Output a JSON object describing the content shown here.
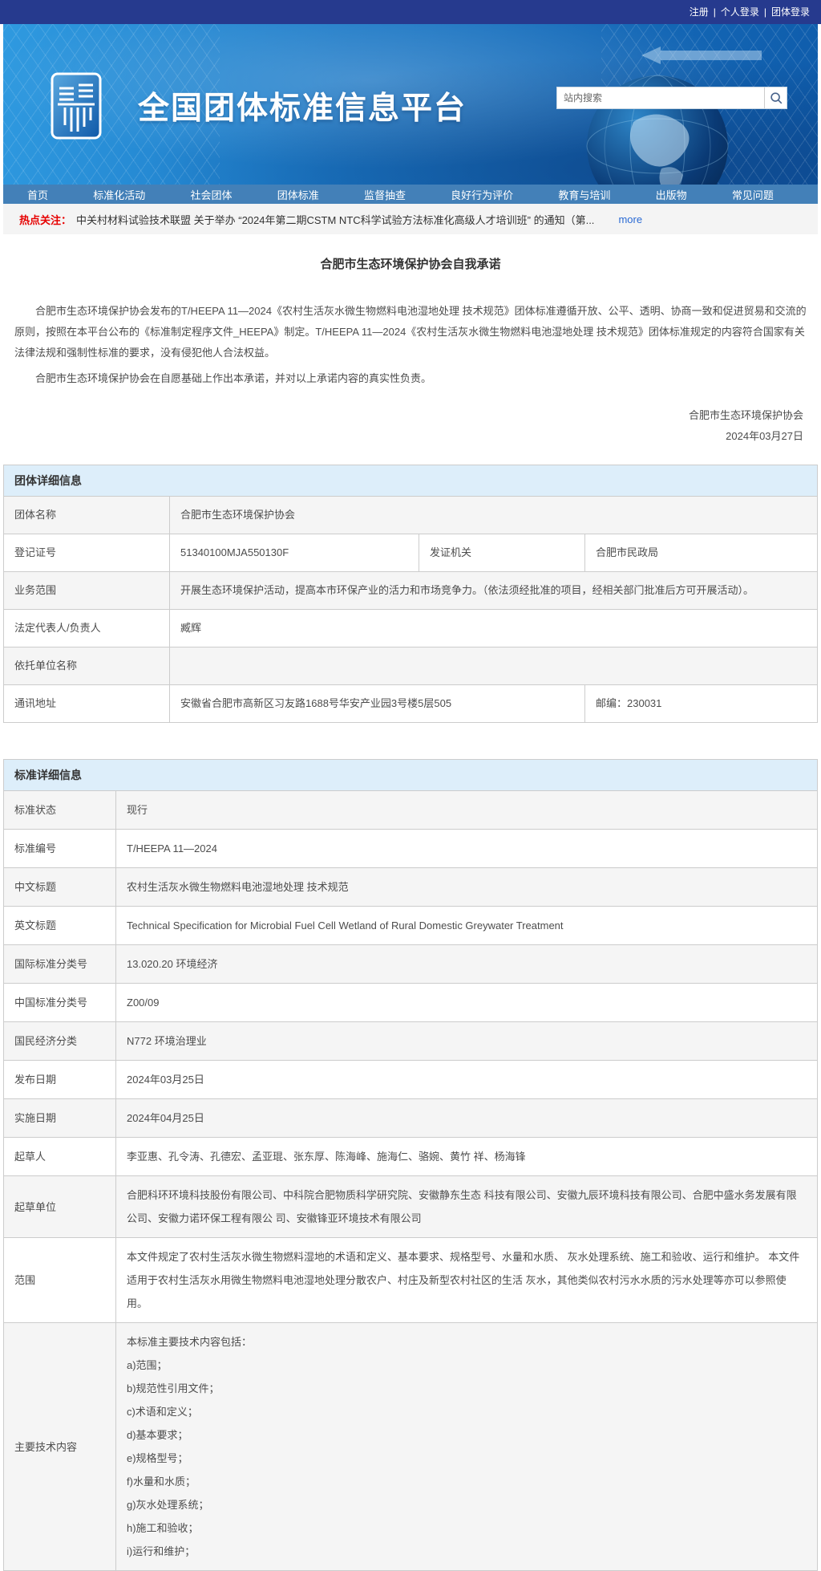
{
  "topbar": {
    "links": [
      "注册",
      "个人登录",
      "团体登录"
    ],
    "separator": "|"
  },
  "header": {
    "site_title": "全国团体标准信息平台",
    "search_placeholder": "站内搜索"
  },
  "nav": {
    "items": [
      "首页",
      "标准化活动",
      "社会团体",
      "团体标准",
      "监督抽查",
      "良好行为评价",
      "教育与培训",
      "出版物",
      "常见问题"
    ]
  },
  "hotbar": {
    "label": "热点关注：",
    "text": "中关村材料试验技术联盟 关于举办 “2024年第二期CSTM NTC科学试验方法标准化高级人才培训班” 的通知（第...",
    "more": "more"
  },
  "article": {
    "title": "合肥市生态环境保护协会自我承诺",
    "p1": "合肥市生态环境保护协会发布的T/HEEPA 11—2024《农村生活灰水微生物燃料电池湿地处理 技术规范》团体标准遵循开放、公平、透明、协商一致和促进贸易和交流的原则，按照在本平台公布的《标准制定程序文件_HEEPA》制定。T/HEEPA 11—2024《农村生活灰水微生物燃料电池湿地处理 技术规范》团体标准规定的内容符合国家有关法律法规和强制性标准的要求，没有侵犯他人合法权益。",
    "p2": "合肥市生态环境保护协会在自愿基础上作出本承诺，并对以上承诺内容的真实性负责。",
    "sign_name": "合肥市生态环境保护协会",
    "sign_date": "2024年03月27日"
  },
  "group_table": {
    "title": "团体详细信息",
    "name_label": "团体名称",
    "name_value": "合肥市生态环境保护协会",
    "reg_label": "登记证号",
    "reg_value": "51340100MJA550130F",
    "issuer_label": "发证机关",
    "issuer_value": "合肥市民政局",
    "scope_label": "业务范围",
    "scope_value": "开展生态环境保护活动，提高本市环保产业的活力和市场竞争力。（依法须经批准的项目，经相关部门批准后方可开展活动）。",
    "rep_label": "法定代表人/负责人",
    "rep_value": "臧辉",
    "unit_label": "依托单位名称",
    "unit_value": "",
    "addr_label": "通讯地址",
    "addr_value": "安徽省合肥市高新区习友路1688号华安产业园3号楼5层505",
    "postal_value": "邮编：230031"
  },
  "standard_table": {
    "title": "标准详细信息",
    "rows": [
      {
        "label": "标准状态",
        "value": "现行"
      },
      {
        "label": "标准编号",
        "value": "T/HEEPA 11—2024"
      },
      {
        "label": "中文标题",
        "value": "农村生活灰水微生物燃料电池湿地处理 技术规范"
      },
      {
        "label": "英文标题",
        "value": "Technical Specification for Microbial Fuel Cell Wetland of Rural Domestic Greywater Treatment"
      },
      {
        "label": "国际标准分类号",
        "value": "13.020.20 环境经济"
      },
      {
        "label": "中国标准分类号",
        "value": "Z00/09"
      },
      {
        "label": "国民经济分类",
        "value": "N772 环境治理业"
      },
      {
        "label": "发布日期",
        "value": "2024年03月25日"
      },
      {
        "label": "实施日期",
        "value": "2024年04月25日"
      },
      {
        "label": "起草人",
        "value": "李亚惠、孔令涛、孔德宏、孟亚琨、张东厚、陈海峰、施海仁、骆婉、黄竹 祥、杨海锋"
      },
      {
        "label": "起草单位",
        "value": "合肥科环环境科技股份有限公司、中科院合肥物质科学研究院、安徽静东生态 科技有限公司、安徽九辰环境科技有限公司、合肥中盛水务发展有限公司、安徽力诺环保工程有限公 司、安徽锋亚环境技术有限公司"
      },
      {
        "label": "范围",
        "value": "本文件规定了农村生活灰水微生物燃料湿地的术语和定义、基本要求、规格型号、水量和水质、 灰水处理系统、施工和验收、运行和维护。 本文件适用于农村生活灰水用微生物燃料电池湿地处理分散农户、村庄及新型农村社区的生活 灰水，其他类似农村污水水质的污水处理等亦可以参照使用。"
      },
      {
        "label": "主要技术内容",
        "value": "本标准主要技术内容包括：\na)范围；\nb)规范性引用文件；\nc)术语和定义；\nd)基本要求；\ne)规格型号；\nf)水量和水质；\ng)灰水处理系统；\nh)施工和验收；\ni)运行和维护；"
      }
    ]
  },
  "colors": {
    "topbar_bg": "#263a8e",
    "nav_bg": "#4380b8",
    "hot_label_red": "#e60000",
    "link_blue": "#2a6ad4",
    "table_header_bg": "#ddeefa"
  }
}
